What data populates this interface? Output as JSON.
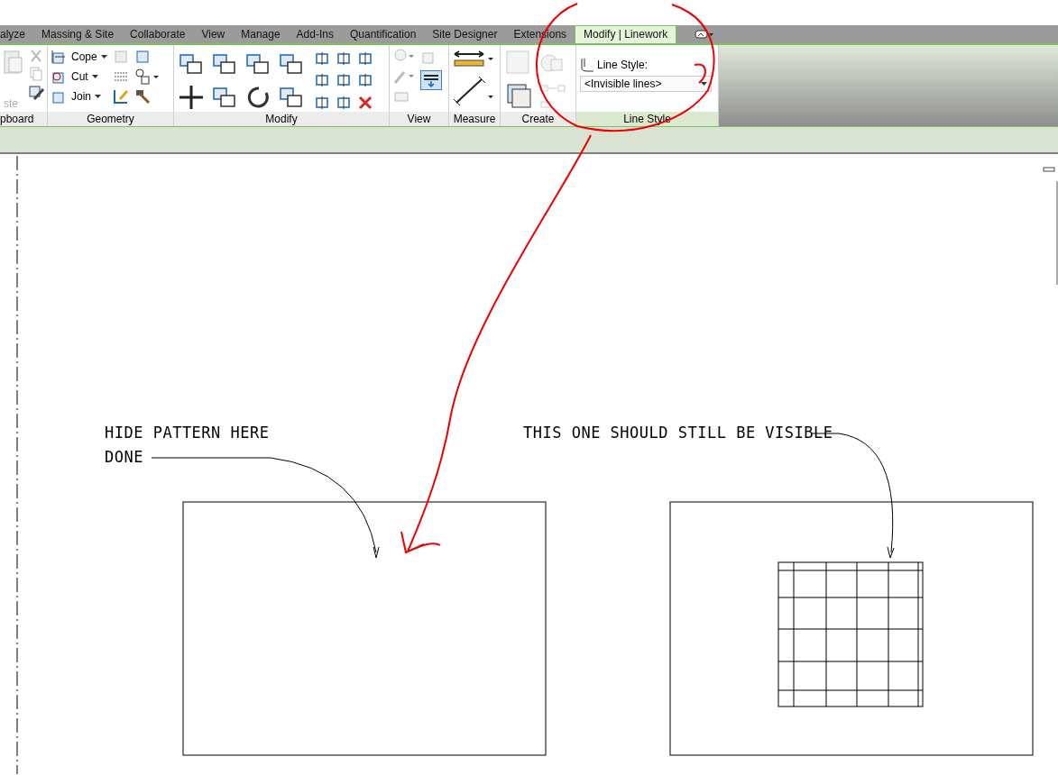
{
  "tabs": [
    {
      "label": "alyze",
      "selected": false
    },
    {
      "label": "Massing & Site",
      "selected": false
    },
    {
      "label": "Collaborate",
      "selected": false
    },
    {
      "label": "View",
      "selected": false
    },
    {
      "label": "Manage",
      "selected": false
    },
    {
      "label": "Add-Ins",
      "selected": false
    },
    {
      "label": "Quantification",
      "selected": false
    },
    {
      "label": "Site Designer",
      "selected": false
    },
    {
      "label": "Extensions",
      "selected": false
    },
    {
      "label": "Modify | Linework",
      "selected": true
    }
  ],
  "ribbon": {
    "panels": [
      {
        "kind": "clipboard",
        "label": "pboard",
        "paste_label": "ste"
      },
      {
        "kind": "geometry",
        "label": "Geometry",
        "buttons": [
          "Cope",
          "Cut",
          "Join"
        ]
      },
      {
        "kind": "modify",
        "label": "Modify"
      },
      {
        "kind": "view",
        "label": "View"
      },
      {
        "kind": "measure",
        "label": "Measure"
      },
      {
        "kind": "create",
        "label": "Create"
      },
      {
        "kind": "linestyle",
        "label": "Line Style",
        "field_label": "Line Style:",
        "value": "<Invisible lines>"
      }
    ]
  },
  "canvas": {
    "notes": [
      {
        "text": "HIDE PATTERN HERE"
      },
      {
        "text": "DONE"
      },
      {
        "text": "THIS ONE SHOULD STILL BE VISIBLE"
      }
    ],
    "regions": [
      {
        "pattern_visible": false
      },
      {
        "pattern_visible": true
      }
    ]
  }
}
